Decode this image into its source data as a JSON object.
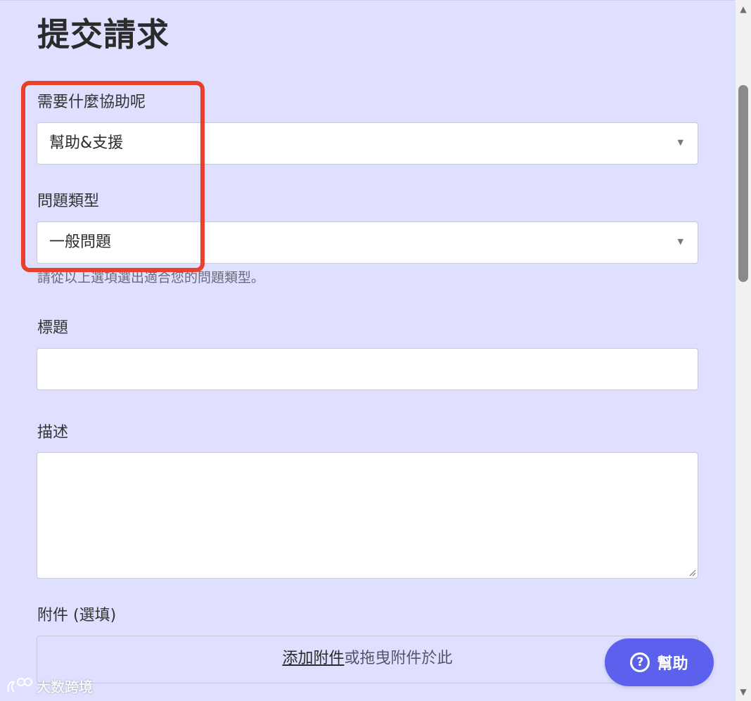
{
  "page": {
    "title": "提交請求"
  },
  "form": {
    "help_label": "需要什麼協助呢",
    "help_value": "幫助&支援",
    "issue_type_label": "問題類型",
    "issue_type_value": "一般問題",
    "issue_type_hint": "請從以上選項選出適合您的問題類型。",
    "subject_label": "標題",
    "subject_value": "",
    "description_label": "描述",
    "description_value": "",
    "attachments_label": "附件 (選填)",
    "attachments_link": "添加附件",
    "attachments_text": "或拖曳附件於此"
  },
  "help_widget": {
    "label": "幫助",
    "icon": "question-circle-icon"
  },
  "watermark": {
    "text": "大数跨境"
  },
  "colors": {
    "page_bg": "#dfe0ff",
    "highlight": "#e8402b",
    "help_button": "#5b61ec"
  }
}
